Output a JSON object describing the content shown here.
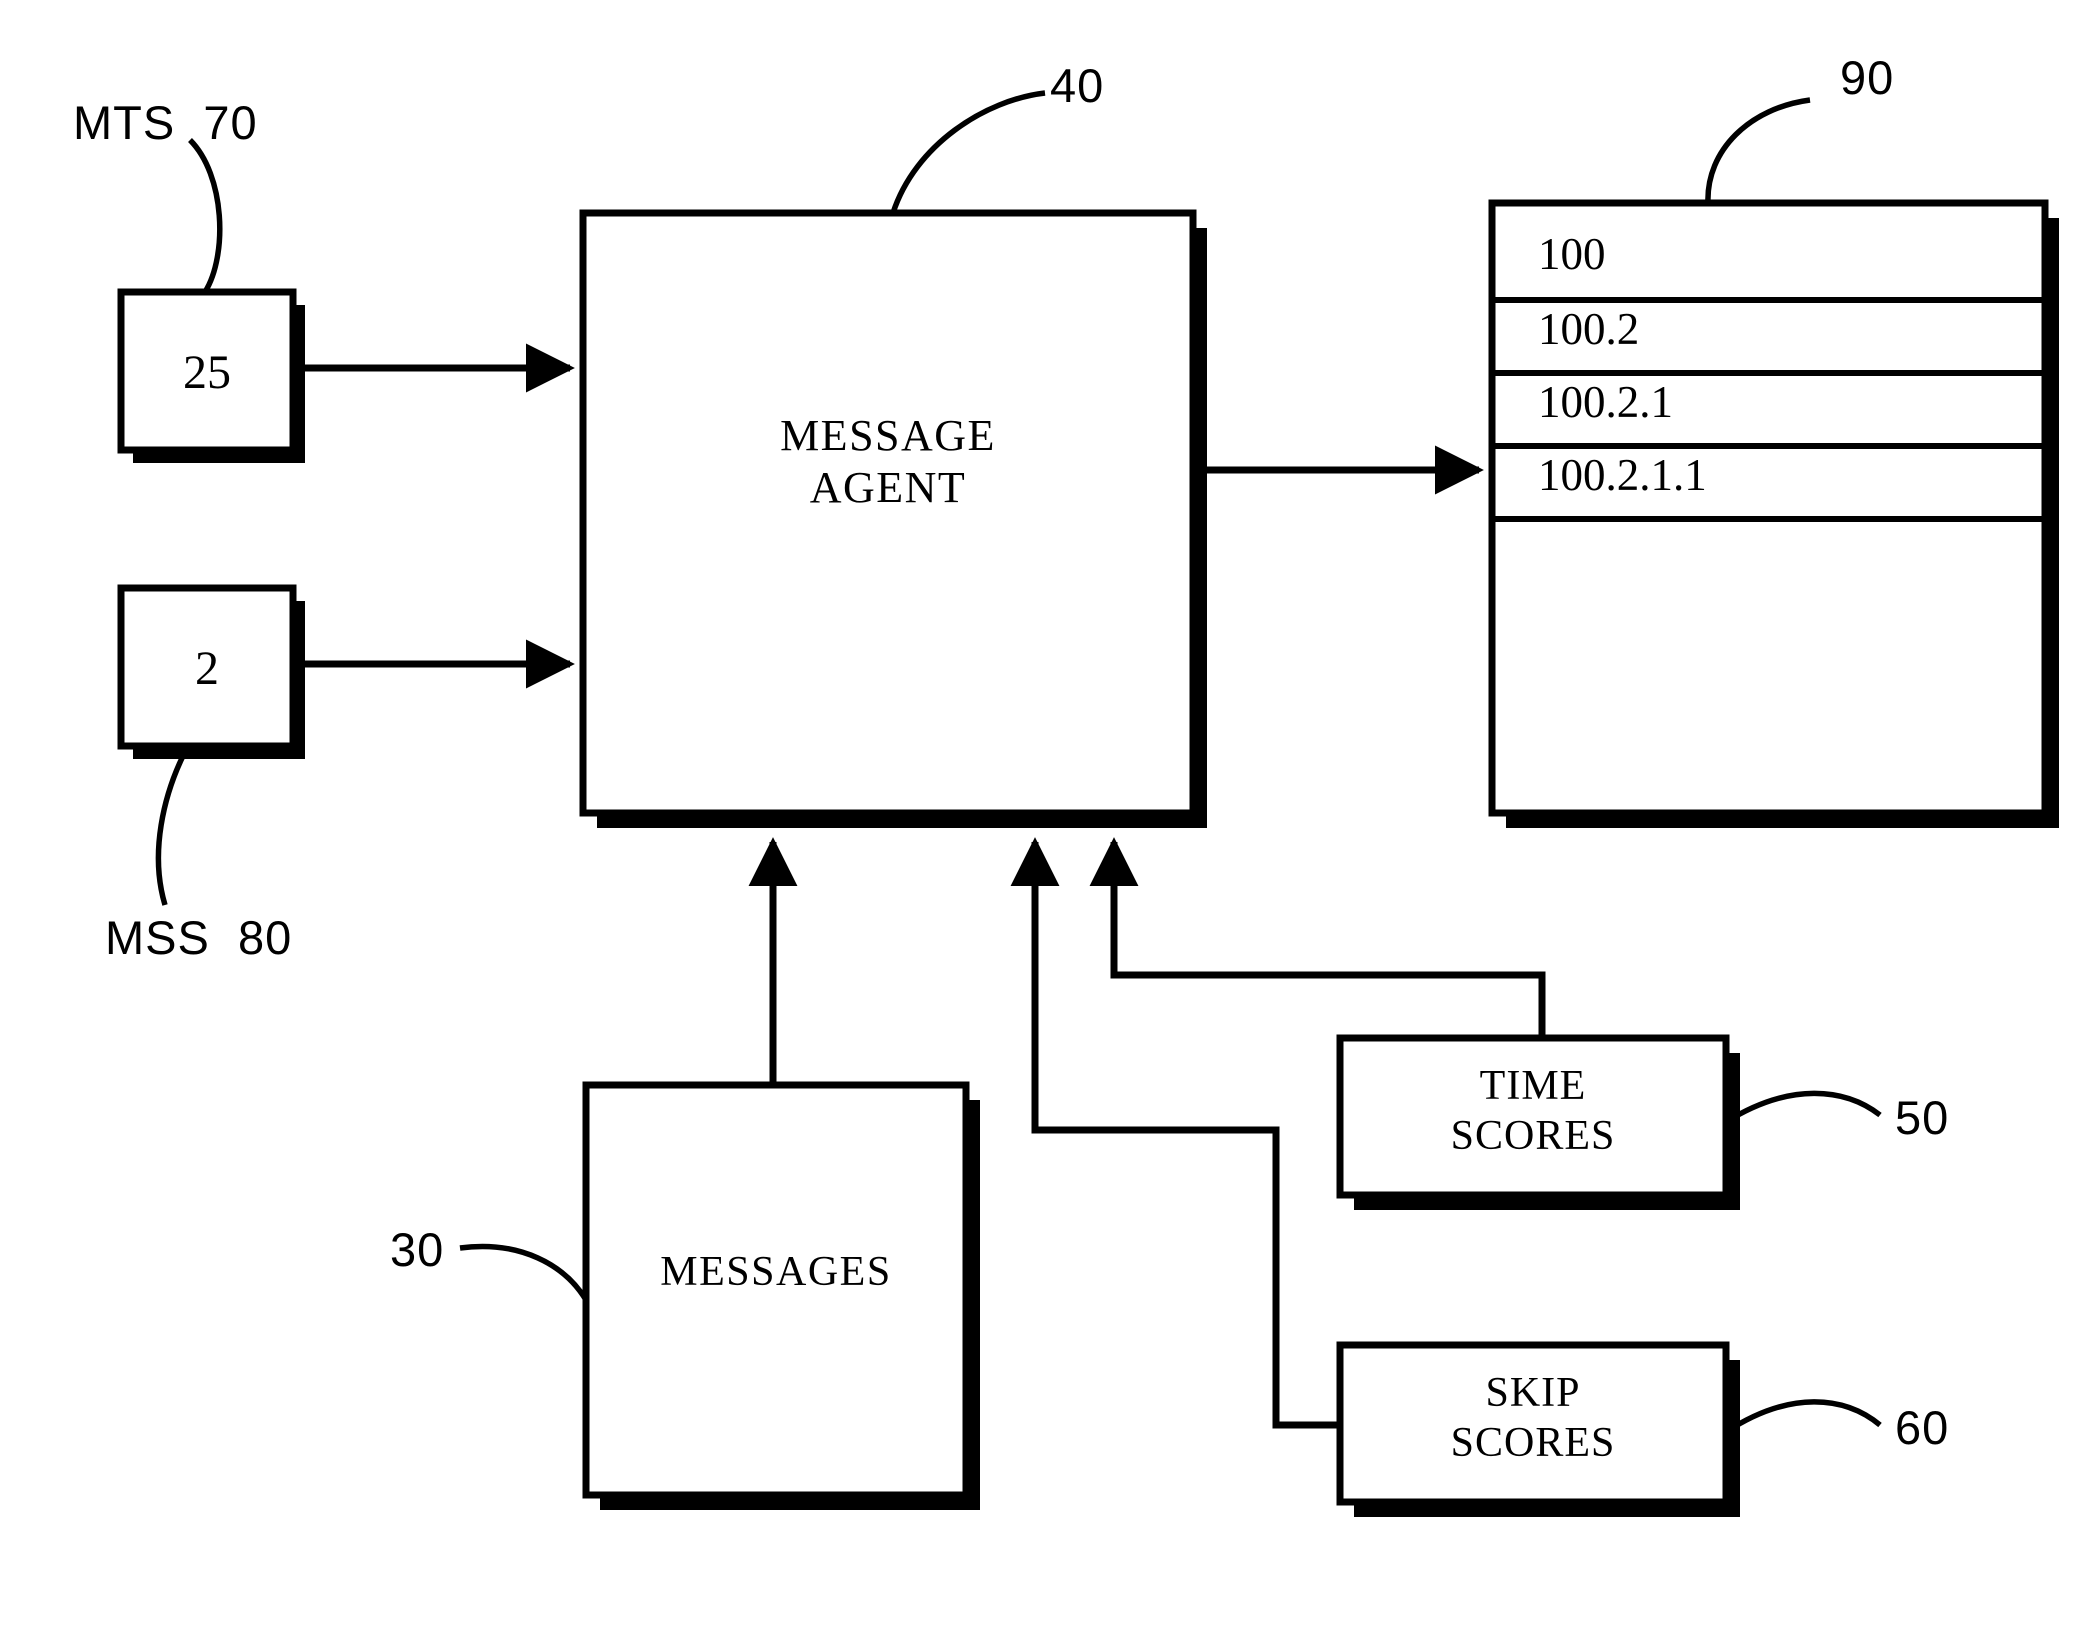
{
  "figure": {
    "title": "Message Agent block diagram",
    "background_color": "#ffffff",
    "line_color": "#000000"
  },
  "blocks": {
    "mts_box": {
      "value": "25",
      "ref_label": "MTS  70"
    },
    "mss_box": {
      "value": "2",
      "ref_label": "MSS  80"
    },
    "message_agent": {
      "label": "MESSAGE\nAGENT",
      "ref_label": "40"
    },
    "messages": {
      "label": "MESSAGES",
      "ref_label": "30"
    },
    "time_scores": {
      "label": "TIME\nSCORES",
      "ref_label": "50"
    },
    "skip_scores": {
      "label": "SKIP\nSCORES",
      "ref_label": "60"
    },
    "table": {
      "ref_label": "90",
      "rows": [
        "100",
        "100.2",
        "100.2.1",
        "100.2.1.1"
      ]
    }
  }
}
